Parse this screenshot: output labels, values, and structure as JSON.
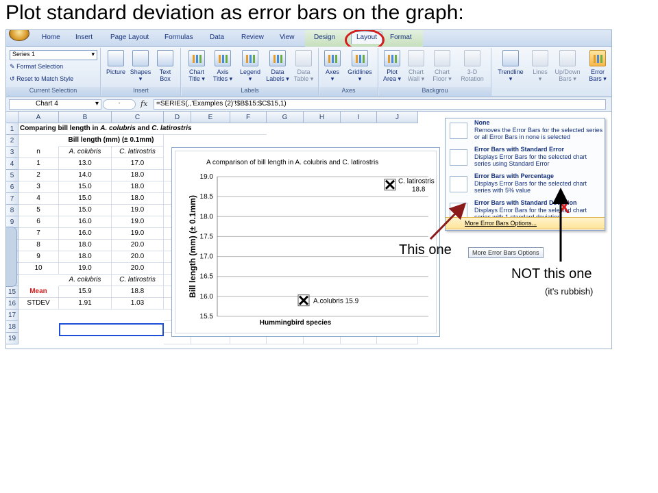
{
  "slide_title": "Plot standard deviation as error bars on the graph:",
  "tabs": [
    "Home",
    "Insert",
    "Page Layout",
    "Formulas",
    "Data",
    "Review",
    "View",
    "Design",
    "Layout",
    "Format"
  ],
  "active_tab": "Layout",
  "ribbon": {
    "current_selection": {
      "series_value": "Series 1",
      "format_selection": "Format Selection",
      "reset_to_match_style": "Reset to Match Style",
      "label": "Current Selection"
    },
    "insert": {
      "picture": "Picture",
      "shapes": "Shapes",
      "text_box_1": "Text",
      "text_box_2": "Box",
      "label": "Insert"
    },
    "labels": {
      "chart_title_1": "Chart",
      "chart_title_2": "Title ▾",
      "axis_titles_1": "Axis",
      "axis_titles_2": "Titles ▾",
      "legend": "Legend",
      "data_labels_1": "Data",
      "data_labels_2": "Labels ▾",
      "data_table_1": "Data",
      "data_table_2": "Table ▾",
      "label": "Labels"
    },
    "axes": {
      "axes": "Axes",
      "gridlines": "Gridlines",
      "label": "Axes"
    },
    "background": {
      "plot_area_1": "Plot",
      "plot_area_2": "Area ▾",
      "chart_wall_1": "Chart",
      "chart_wall_2": "Wall ▾",
      "chart_floor_1": "Chart",
      "chart_floor_2": "Floor ▾",
      "rotation_1": "3-D",
      "rotation_2": "Rotation",
      "label": "Backgrou"
    },
    "analysis": {
      "trendline": "Trendline",
      "lines": "Lines",
      "updown_1": "Up/Down",
      "updown_2": "Bars ▾",
      "error_bars_1": "Error",
      "error_bars_2": "Bars ▾"
    }
  },
  "formula_bar": {
    "name_box": "Chart 4",
    "fx": "fx",
    "formula": "=SERIES(,,'Examples (2)'!$B$15:$C$15,1)"
  },
  "columns": [
    "A",
    "B",
    "C",
    "D",
    "E",
    "F",
    "G",
    "H",
    "I",
    "J"
  ],
  "row_numbers": [
    "1",
    "2",
    "3",
    "4",
    "5",
    "6",
    "7",
    "8",
    "9",
    "10",
    "11",
    "12",
    "13",
    "14",
    "15",
    "16",
    "17",
    "18",
    "19"
  ],
  "sheet": {
    "title_1": "Comparing bill length in ",
    "title_species_a": "A. colubris",
    "title_and": " and ",
    "title_species_c": "C. latirostris",
    "subheader": "Bill length (mm) (± 0.1mm)",
    "col_n": "n",
    "col_a": "A. colubris",
    "col_c": "C. latirostris",
    "rows": [
      [
        "1",
        "13.0",
        "17.0"
      ],
      [
        "2",
        "14.0",
        "18.0"
      ],
      [
        "3",
        "15.0",
        "18.0"
      ],
      [
        "4",
        "15.0",
        "18.0"
      ],
      [
        "5",
        "15.0",
        "19.0"
      ],
      [
        "6",
        "16.0",
        "19.0"
      ],
      [
        "7",
        "16.0",
        "19.0"
      ],
      [
        "8",
        "18.0",
        "20.0"
      ],
      [
        "9",
        "18.0",
        "20.0"
      ],
      [
        "10",
        "19.0",
        "20.0"
      ]
    ],
    "mean_label": "Mean",
    "mean_a": "15.9",
    "mean_c": "18.8",
    "stdev_label": "STDEV",
    "stdev_a": "1.91",
    "stdev_c": "1.03"
  },
  "chart_data": {
    "type": "scatter",
    "title": "A comparison of bill length in A. colubris and C. latirostris",
    "xlabel": "Hummingbird species",
    "ylabel": "Bill length (mm) (± 0.1mm)",
    "ylim": [
      15.5,
      19.0
    ],
    "yticks": [
      "19.0",
      "18.5",
      "18.0",
      "17.5",
      "17.0",
      "16.5",
      "16.0",
      "15.5"
    ],
    "grid": true,
    "points": [
      {
        "label": "A.colubris 15.9",
        "y": 15.9,
        "order": 1
      },
      {
        "label_1": "C. latirostris",
        "label_2": "18.8",
        "y": 18.8,
        "order": 2
      }
    ]
  },
  "error_bars_menu": {
    "items": [
      {
        "title": "None",
        "desc": "Removes the Error Bars for the selected series or all Error Bars in none is selected"
      },
      {
        "title": "Error Bars with Standard Error",
        "desc": "Displays Error Bars for the selected chart series using Standard Error"
      },
      {
        "title": "Error Bars with Percentage",
        "desc": "Displays Error Bars for the selected chart series with 5% value"
      },
      {
        "title": "Error Bars with Standard Deviation",
        "desc": "Displays Error Bars for the selected chart series with 1 standard deviation"
      }
    ],
    "more_options": "More Error Bars Options...",
    "tooltip": "More Error Bars Options",
    "wrong_mark": "X"
  },
  "annotations": {
    "this_one": "This one",
    "not_this_one": "NOT this one",
    "rubbish": "(it's rubbish)"
  },
  "colors": {
    "ring": "#d21e1e",
    "arrow_this": "#8b1a1a",
    "arrow_not": "#000000",
    "selection": "#1d4ed8"
  }
}
